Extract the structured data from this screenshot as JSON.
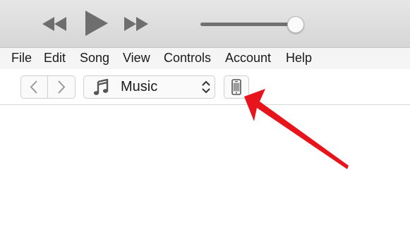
{
  "player": {
    "rewind_icon": "rewind-icon",
    "play_icon": "play-icon",
    "fast_forward_icon": "fast-forward-icon",
    "volume_level": 0.95
  },
  "menu": {
    "items": [
      {
        "label": "File"
      },
      {
        "label": "Edit"
      },
      {
        "label": "Song"
      },
      {
        "label": "View"
      },
      {
        "label": "Controls"
      },
      {
        "label": "Account"
      },
      {
        "label": "Help"
      }
    ]
  },
  "toolbar": {
    "back_icon": "chevron-left-icon",
    "forward_icon": "chevron-right-icon",
    "media_select": {
      "icon": "music-note-icon",
      "value": "Music",
      "chevron_icon": "up-down-chevron-icon"
    },
    "device_icon": "iphone-icon"
  },
  "annotation": {
    "arrow_color": "#e8141c"
  }
}
